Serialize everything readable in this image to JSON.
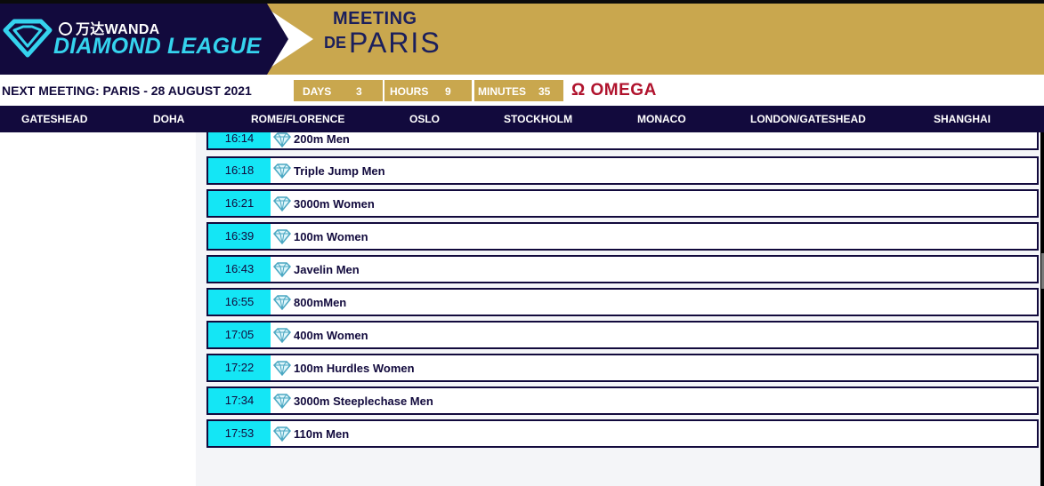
{
  "header": {
    "brand_small": "万达WANDA",
    "brand_title": "DIAMOND LEAGUE",
    "meeting_top": "MEETING",
    "meeting_de": "DE",
    "meeting_city": "PARIS",
    "colors": {
      "navy": "#120a3d",
      "gold": "#c9a74e",
      "cyan": "#35d3ee",
      "omega_red": "#b0132d"
    }
  },
  "next_meeting": {
    "label": "NEXT MEETING: PARIS - 28 AUGUST 2021",
    "days_label": "DAYS",
    "days_value": "3",
    "hours_label": "HOURS",
    "hours_value": "9",
    "minutes_label": "MINUTES",
    "minutes_value": "35",
    "sponsor": "Ω OMEGA"
  },
  "nav": {
    "items": [
      "GATESHEAD",
      "DOHA",
      "ROME/FLORENCE",
      "OSLO",
      "STOCKHOLM",
      "MONACO",
      "LONDON/GATESHEAD",
      "SHANGHAI"
    ]
  },
  "schedule": [
    {
      "time": "16:14",
      "event": "200m Men",
      "icon": "diamond-icon"
    },
    {
      "time": "16:18",
      "event": "Triple Jump Men",
      "icon": "diamond-icon"
    },
    {
      "time": "16:21",
      "event": "3000m Women",
      "icon": "diamond-icon"
    },
    {
      "time": "16:39",
      "event": "100m Women",
      "icon": "diamond-icon"
    },
    {
      "time": "16:43",
      "event": "Javelin Men",
      "icon": "diamond-icon"
    },
    {
      "time": "16:55",
      "event": "800mMen",
      "icon": "diamond-icon"
    },
    {
      "time": "17:05",
      "event": "400m Women",
      "icon": "diamond-icon"
    },
    {
      "time": "17:22",
      "event": "100m Hurdles Women",
      "icon": "diamond-icon"
    },
    {
      "time": "17:34",
      "event": "3000m Steeplechase Men",
      "icon": "diamond-icon"
    },
    {
      "time": "17:53",
      "event": "110m Men",
      "icon": "diamond-icon"
    }
  ]
}
